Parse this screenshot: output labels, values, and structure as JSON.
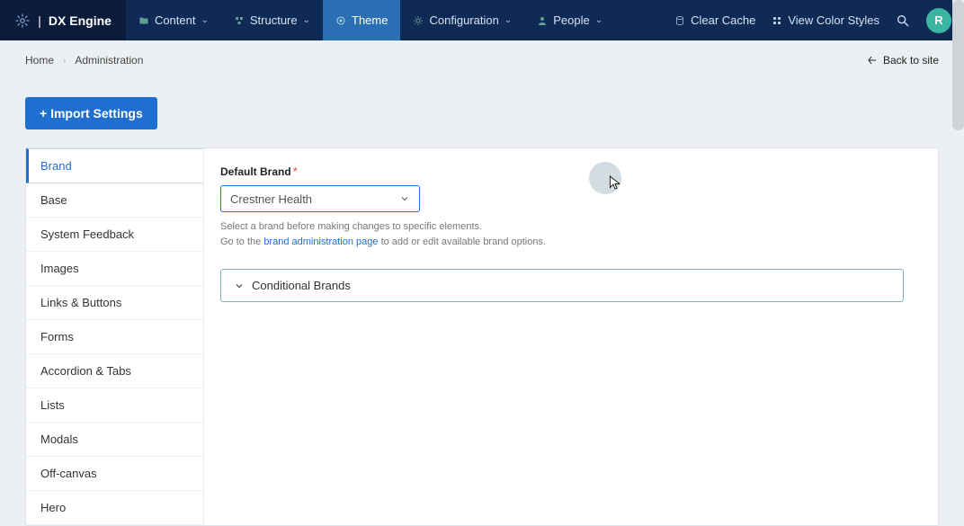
{
  "brand": {
    "name": "DX Engine"
  },
  "nav": {
    "items": [
      {
        "label": "Content",
        "icon": "folder-icon",
        "active": false,
        "chevron": true
      },
      {
        "label": "Structure",
        "icon": "structure-icon",
        "active": false,
        "chevron": true
      },
      {
        "label": "Theme",
        "icon": "theme-icon",
        "active": true,
        "chevron": false
      },
      {
        "label": "Configuration",
        "icon": "gear-icon",
        "active": false,
        "chevron": true
      },
      {
        "label": "People",
        "icon": "person-icon",
        "active": false,
        "chevron": true
      }
    ],
    "actions": {
      "clear_cache": "Clear Cache",
      "view_colors": "View Color Styles"
    },
    "avatar_initial": "R"
  },
  "breadcrumb": {
    "home": "Home",
    "admin": "Administration",
    "back": "Back to site"
  },
  "buttons": {
    "import": "+ Import Settings"
  },
  "sidebar": {
    "items": [
      {
        "label": "Brand",
        "active": true
      },
      {
        "label": "Base"
      },
      {
        "label": "System Feedback"
      },
      {
        "label": "Images"
      },
      {
        "label": "Links & Buttons"
      },
      {
        "label": "Forms"
      },
      {
        "label": "Accordion & Tabs"
      },
      {
        "label": "Lists"
      },
      {
        "label": "Modals"
      },
      {
        "label": "Off-canvas"
      },
      {
        "label": "Hero"
      }
    ]
  },
  "form": {
    "default_brand_label": "Default Brand",
    "required_mark": "*",
    "default_brand_value": "Crestner Health",
    "help_line1": "Select a brand before making changes to specific elements.",
    "help_line2_prefix": "Go to the ",
    "help_link": "brand administration page",
    "help_line2_suffix": " to add or edit available brand options.",
    "accordion_title": "Conditional Brands"
  }
}
